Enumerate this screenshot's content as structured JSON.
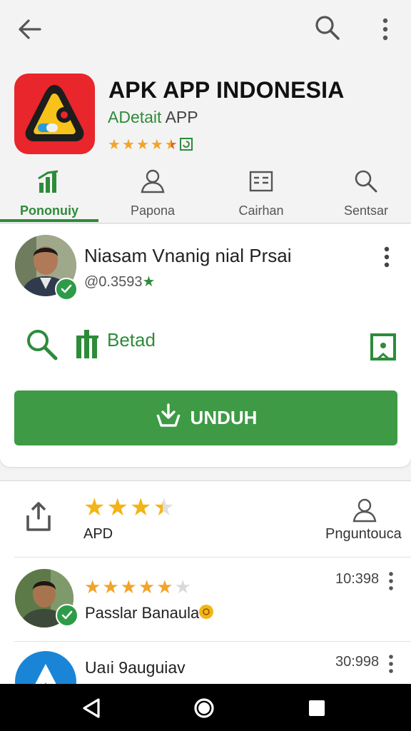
{
  "app": {
    "title": "APK APP INDONESIA",
    "subtitle_green": "ADetait",
    "subtitle_gray": "APP",
    "rating_stars": 4.5
  },
  "tabs": [
    {
      "label": "Pononuiy",
      "icon": "chart-bars-icon",
      "active": true
    },
    {
      "label": "Papona",
      "icon": "person-icon",
      "active": false
    },
    {
      "label": "Cairhan",
      "icon": "list-box-icon",
      "active": false
    },
    {
      "label": "Sentsar",
      "icon": "search-icon",
      "active": false
    }
  ],
  "developer": {
    "name": "Niasam Vnanig nial  Prsai",
    "id_text": "@0.3593",
    "id_star": "★"
  },
  "actions": {
    "beta_label": "Betad"
  },
  "download": {
    "label": "UNDUH"
  },
  "rating_row": {
    "label": "APD",
    "right_label": "Pnguntouca",
    "stars": 3.5
  },
  "reviews": [
    {
      "name": "Passlar Banaula",
      "time": "10:398",
      "stars": 5
    },
    {
      "name": "Uaıi 9auguiav",
      "time": "30:998"
    }
  ],
  "colors": {
    "accent_green": "#2e8b3a",
    "button_green": "#3e9a45",
    "star_gold": "#f1a42a",
    "app_icon_red": "#e8262b"
  }
}
